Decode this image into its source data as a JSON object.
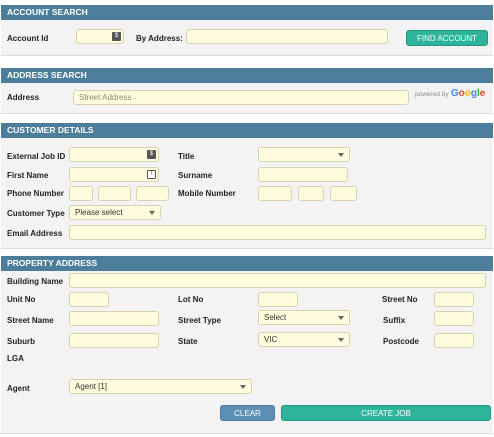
{
  "account_search": {
    "header": "ACCOUNT SEARCH",
    "account_id_label": "Account Id",
    "by_address_label": "By Address:",
    "find_button": "FIND ACCOUNT"
  },
  "address_search": {
    "header": "ADDRESS SEARCH",
    "address_label": "Address",
    "address_placeholder": "Street Address",
    "powered_by": "powered by",
    "google": [
      "G",
      "o",
      "o",
      "g",
      "l",
      "e"
    ],
    "google_colors": [
      "#4285F4",
      "#EA4335",
      "#FBBC05",
      "#4285F4",
      "#34A853",
      "#EA4335"
    ]
  },
  "customer_details": {
    "header": "CUSTOMER DETAILS",
    "external_job_id_label": "External Job ID",
    "title_label": "Title",
    "first_name_label": "First Name",
    "surname_label": "Surname",
    "phone_label": "Phone Number",
    "mobile_label": "Mobile Number",
    "customer_type_label": "Customer Type",
    "customer_type_value": "Please select",
    "email_label": "Email Address"
  },
  "property_address": {
    "header": "PROPERTY ADDRESS",
    "building_name_label": "Building Name",
    "unit_no_label": "Unit No",
    "lot_no_label": "Lot No",
    "street_no_label": "Street No",
    "street_name_label": "Street Name",
    "street_type_label": "Street Type",
    "street_type_value": "Select",
    "suffix_label": "Suffix",
    "suburb_label": "Suburb",
    "state_label": "State",
    "state_value": "VIC",
    "postcode_label": "Postcode",
    "lga_label": "LGA",
    "agent_label": "Agent",
    "agent_value": "Agent [1]"
  },
  "actions": {
    "clear_button": "CLEAR",
    "create_job_button": "CREATE JOB"
  },
  "colors": {
    "header_bg": "#4c7d9a",
    "field_bg": "#fffddd",
    "primary_button": "#2cb59a",
    "secondary_button": "#5b8fb4"
  }
}
